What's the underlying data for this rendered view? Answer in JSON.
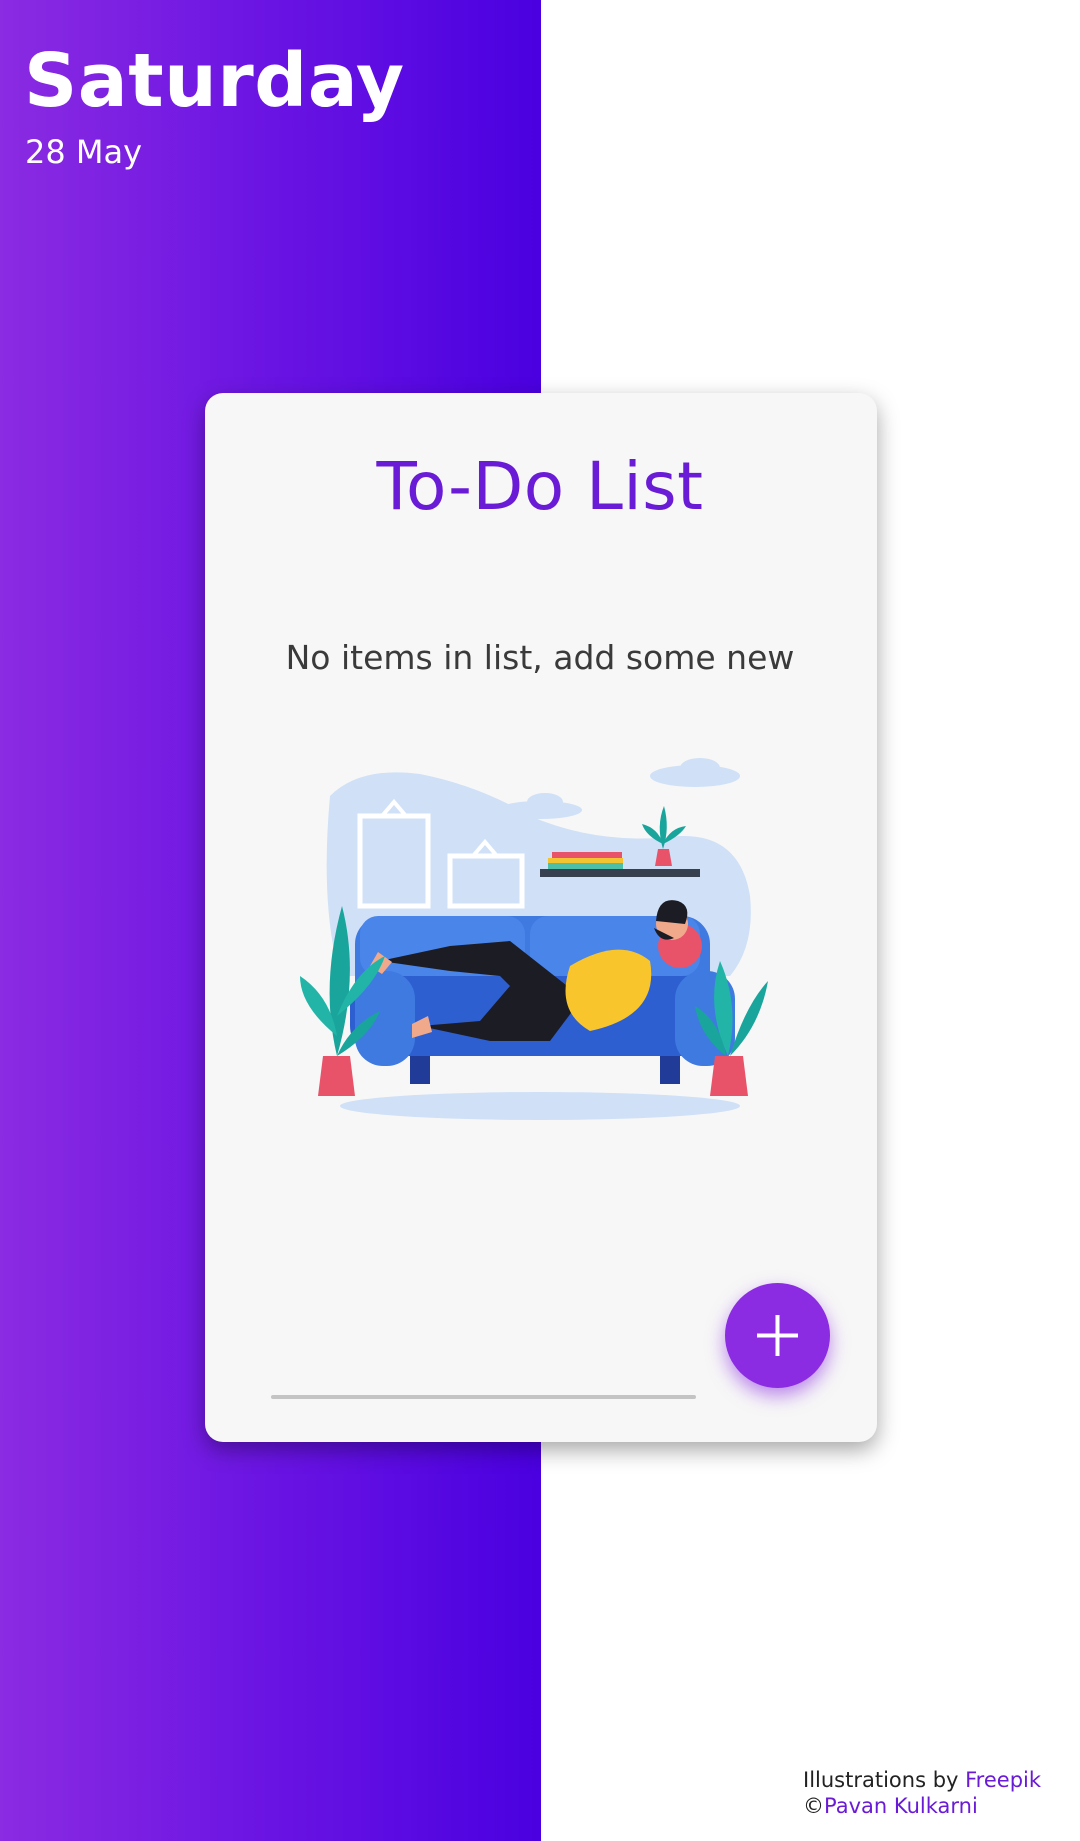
{
  "header": {
    "day": "Saturday",
    "date": "28 May"
  },
  "card": {
    "title": "To-Do List",
    "empty_message": "No items in list, add some new"
  },
  "fab": {
    "icon": "plus-icon",
    "color": "#8b2be2"
  },
  "credits": {
    "illustrations_prefix": "Illustrations by ",
    "illustrations_link": "Freepik",
    "copyright_symbol": "©",
    "author_link": "Pavan Kulkarni"
  },
  "colors": {
    "gradient_start": "#8b2be2",
    "gradient_end": "#4a00e0",
    "accent": "#6a1bd6"
  }
}
